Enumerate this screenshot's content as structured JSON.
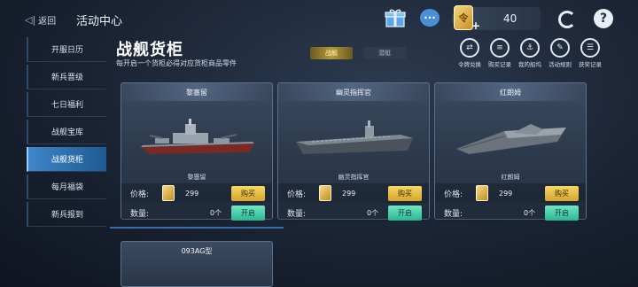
{
  "header": {
    "back_label": "返回",
    "title": "活动中心",
    "currency_value": "40",
    "currency_token_glyph": "令",
    "currency_plus": "+",
    "chat_glyph": "···",
    "help_glyph": "?"
  },
  "sidebar": {
    "items": [
      {
        "label": "开服日历"
      },
      {
        "label": "新兵晋级"
      },
      {
        "label": "七日福利"
      },
      {
        "label": "战舰宝库"
      },
      {
        "label": "战舰货柜"
      },
      {
        "label": "每月福袋"
      },
      {
        "label": "新兵报到"
      }
    ],
    "active_index": 4
  },
  "main": {
    "heading": "战舰货柜",
    "subheading": "每开启一个货柜必得对应货柜商品零件",
    "tabs": [
      {
        "label": "战舰"
      },
      {
        "label": "潜艇"
      }
    ],
    "tools": [
      {
        "label": "令牌兑换",
        "icon": "exchange-icon"
      },
      {
        "label": "购买记录",
        "icon": "purchase-record-icon"
      },
      {
        "label": "我的船坞",
        "icon": "dock-icon"
      },
      {
        "label": "活动规则",
        "icon": "rules-icon"
      },
      {
        "label": "获奖记录",
        "icon": "award-record-icon"
      }
    ]
  },
  "cards": [
    {
      "name": "黎塞留",
      "sub": "黎塞留",
      "price_label": "价格:",
      "price": "299",
      "buy": "购买",
      "qty_label": "数量:",
      "qty": "0个",
      "open": "开启"
    },
    {
      "name": "幽灵指挥官",
      "sub": "幽灵指挥官",
      "price_label": "价格:",
      "price": "299",
      "buy": "购买",
      "qty_label": "数量:",
      "qty": "0个",
      "open": "开启"
    },
    {
      "name": "红朗姆",
      "sub": "红朗姆",
      "price_label": "价格:",
      "price": "299",
      "buy": "购买",
      "qty_label": "数量:",
      "qty": "0个",
      "open": "开启"
    }
  ],
  "next_card": {
    "name": "093AG型"
  },
  "colors": {
    "accent": "#3f86c9",
    "buy": "#f2cf5c",
    "open": "#46d0ab",
    "token": "#e7b84a"
  }
}
